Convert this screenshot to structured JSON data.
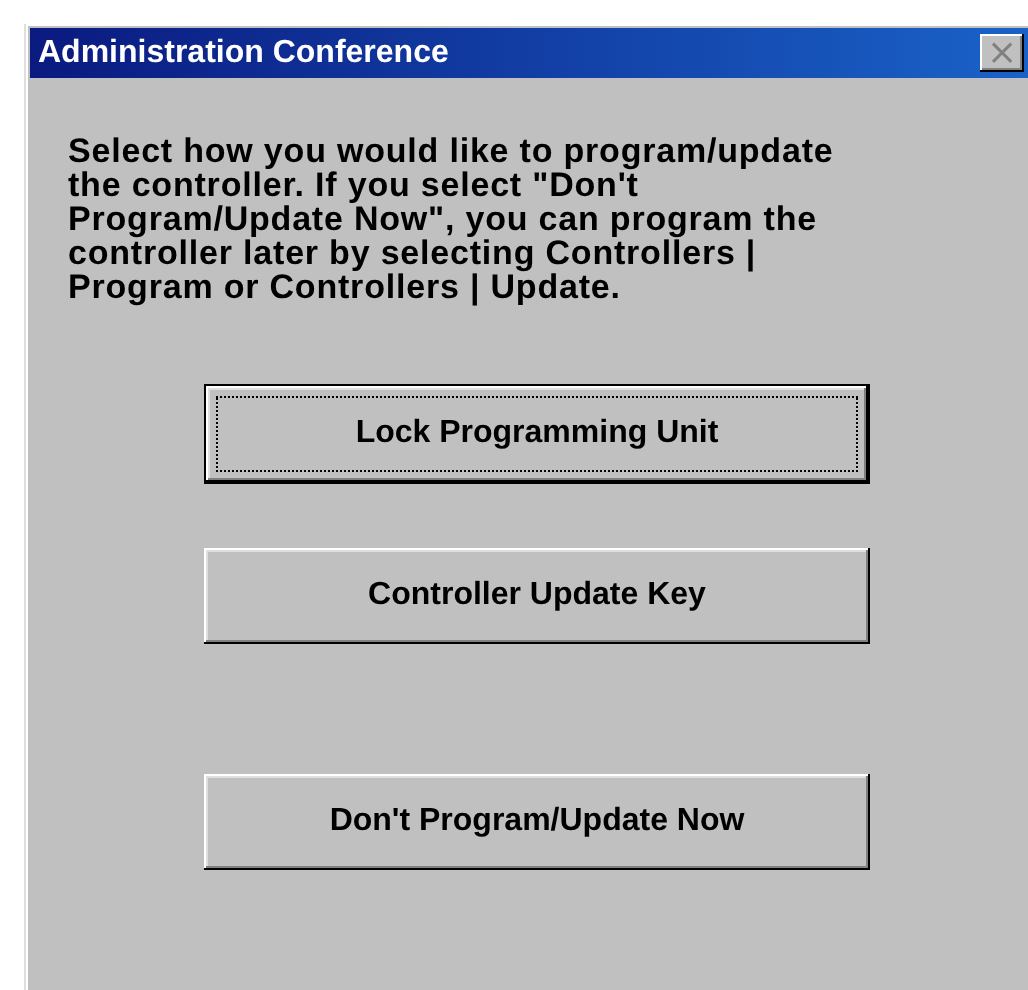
{
  "window": {
    "title": "Administration Conference",
    "close_glyph": "×"
  },
  "message": "Select how you would like to program/update the controller. If you select \"Don't Program/Update Now\",  you can program the controller later by selecting Controllers | Program  or Controllers | Update.",
  "buttons": [
    {
      "label": "Lock Programming Unit",
      "focused": true
    },
    {
      "label": "Controller Update Key",
      "focused": false
    },
    {
      "label": "Don't Program/Update Now",
      "focused": false
    }
  ]
}
